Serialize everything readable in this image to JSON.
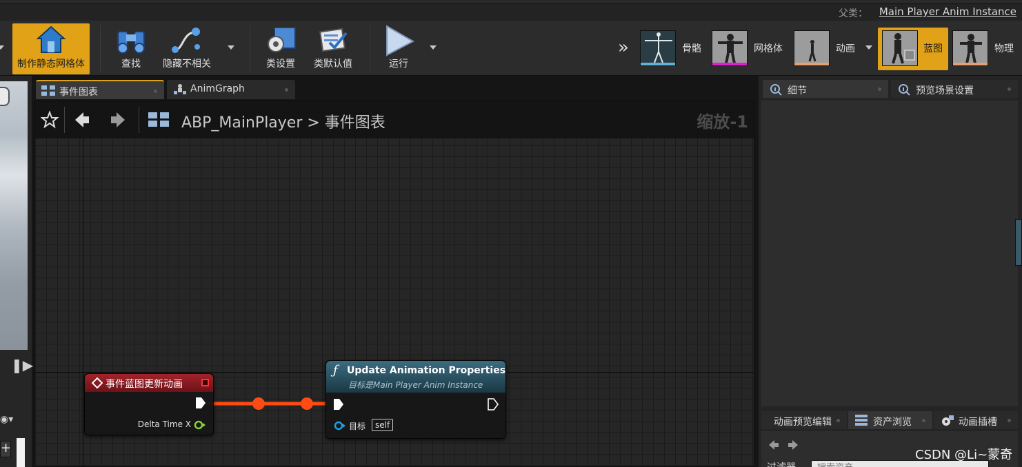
{
  "window": {
    "parent_label": "父类：",
    "parent_value": "Main Player Anim Instance"
  },
  "toolbar": {
    "make_static_mesh": "制作静态网格体",
    "find": "查找",
    "hide_unrelated": "隐藏不相关",
    "class_settings": "类设置",
    "class_defaults": "类默认值",
    "run": "运行"
  },
  "modes": {
    "skeleton": "骨骼",
    "mesh": "网格体",
    "animation": "动画",
    "blueprint": "蓝图",
    "physics": "物理"
  },
  "tabs": {
    "event_graph": "事件图表",
    "anim_graph": "AnimGraph"
  },
  "graph": {
    "breadcrumb": "ABP_MainPlayer > 事件图表",
    "zoom": "缩放-1"
  },
  "nodes": {
    "event": {
      "title": "事件蓝图更新动画",
      "pin_delta": "Delta Time X"
    },
    "function": {
      "title": "Update Animation Properties",
      "subtitle": "目标是Main Player Anim Instance",
      "pin_target": "目标",
      "pin_target_value": "self"
    }
  },
  "right_panel": {
    "details_tab": "细节",
    "preview_scene_tab": "预览场景设置",
    "anim_preview_tab": "动画预览编辑",
    "asset_browser_tab": "资产浏览",
    "anim_slots_tab": "动画插槽",
    "filter_label": "过滤器",
    "search_placeholder": "搜索资产"
  },
  "watermark": "CSDN @Li~蒙奇",
  "colors": {
    "accent": "#e1a218",
    "event_header": "#a3232b",
    "function_header": "#3b6c80",
    "exec_wire": "#ff4a12",
    "float_pin": "#8bd12f",
    "object_pin": "#1f9fe5"
  }
}
